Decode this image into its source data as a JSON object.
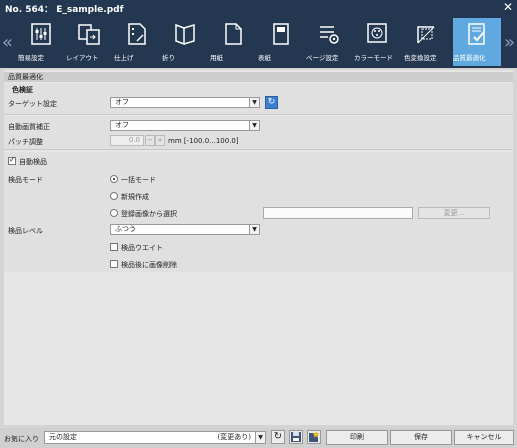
{
  "window": {
    "title": "No. 564： E_sample.pdf"
  },
  "tabs": [
    {
      "label": "簡易設定",
      "icon": "sliders-icon"
    },
    {
      "label": "レイアウト",
      "icon": "layout-icon"
    },
    {
      "label": "仕上げ",
      "icon": "finishing-icon"
    },
    {
      "label": "折り",
      "icon": "fold-icon"
    },
    {
      "label": "用紙",
      "icon": "paper-icon"
    },
    {
      "label": "表紙",
      "icon": "cover-icon"
    },
    {
      "label": "ページ設定",
      "icon": "page-settings-icon"
    },
    {
      "label": "カラーモード",
      "icon": "color-mode-icon"
    },
    {
      "label": "色変換設定",
      "icon": "color-conversion-icon"
    },
    {
      "label": "品質最適化",
      "icon": "quality-icon"
    }
  ],
  "active_tab": "品質最適化",
  "section": {
    "title": "品質最適化",
    "color_verify": {
      "title": "色検証",
      "target_label": "ターゲット設定",
      "target_value": "オフ",
      "auto_quality_label": "自動画質補正",
      "auto_quality_value": "オフ",
      "patch_label": "パッチ調整",
      "patch_value": "0.0",
      "patch_range": "mm [-100.0...100.0]"
    },
    "auto_inspect": {
      "checkbox_label": "自動検品",
      "checked": true,
      "mode_label": "検品モード",
      "modes": [
        "一括モード",
        "新規作成",
        "登録画像から選択"
      ],
      "selected_mode": "一括モード",
      "change_button": "変更...",
      "level_label": "検品レベル",
      "level_value": "ふつう",
      "wait_label": "検品ウエイト",
      "delete_label": "検品後に画像削除"
    }
  },
  "footer": {
    "favorites_label": "お気に入り",
    "favorites_value": "元の設定",
    "favorites_state": "(変更あり)",
    "print_button": "印刷",
    "save_button": "保存",
    "cancel_button": "キャンセル"
  }
}
